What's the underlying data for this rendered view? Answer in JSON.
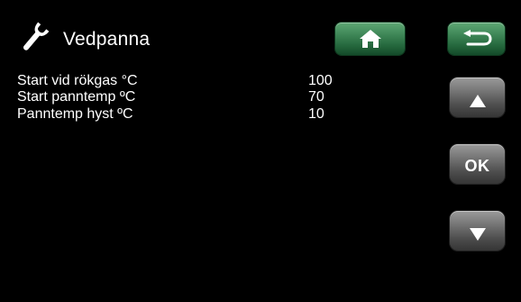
{
  "header": {
    "icon": "wrench-icon",
    "title": "Vedpanna"
  },
  "buttons": {
    "home_icon": "home-icon",
    "back_icon": "back-arrow-icon",
    "up_icon": "arrow-up-icon",
    "ok_label": "OK",
    "down_icon": "arrow-down-icon"
  },
  "params": [
    {
      "label": "Start vid rökgas °C",
      "value": "100"
    },
    {
      "label": "Start panntemp ºC",
      "value": "70"
    },
    {
      "label": "Panntemp hyst ºC",
      "value": "10"
    }
  ],
  "colors": {
    "background": "#000000",
    "text": "#ffffff",
    "green_button": "#2f7a48",
    "gray_button": "#6a6a6a"
  }
}
